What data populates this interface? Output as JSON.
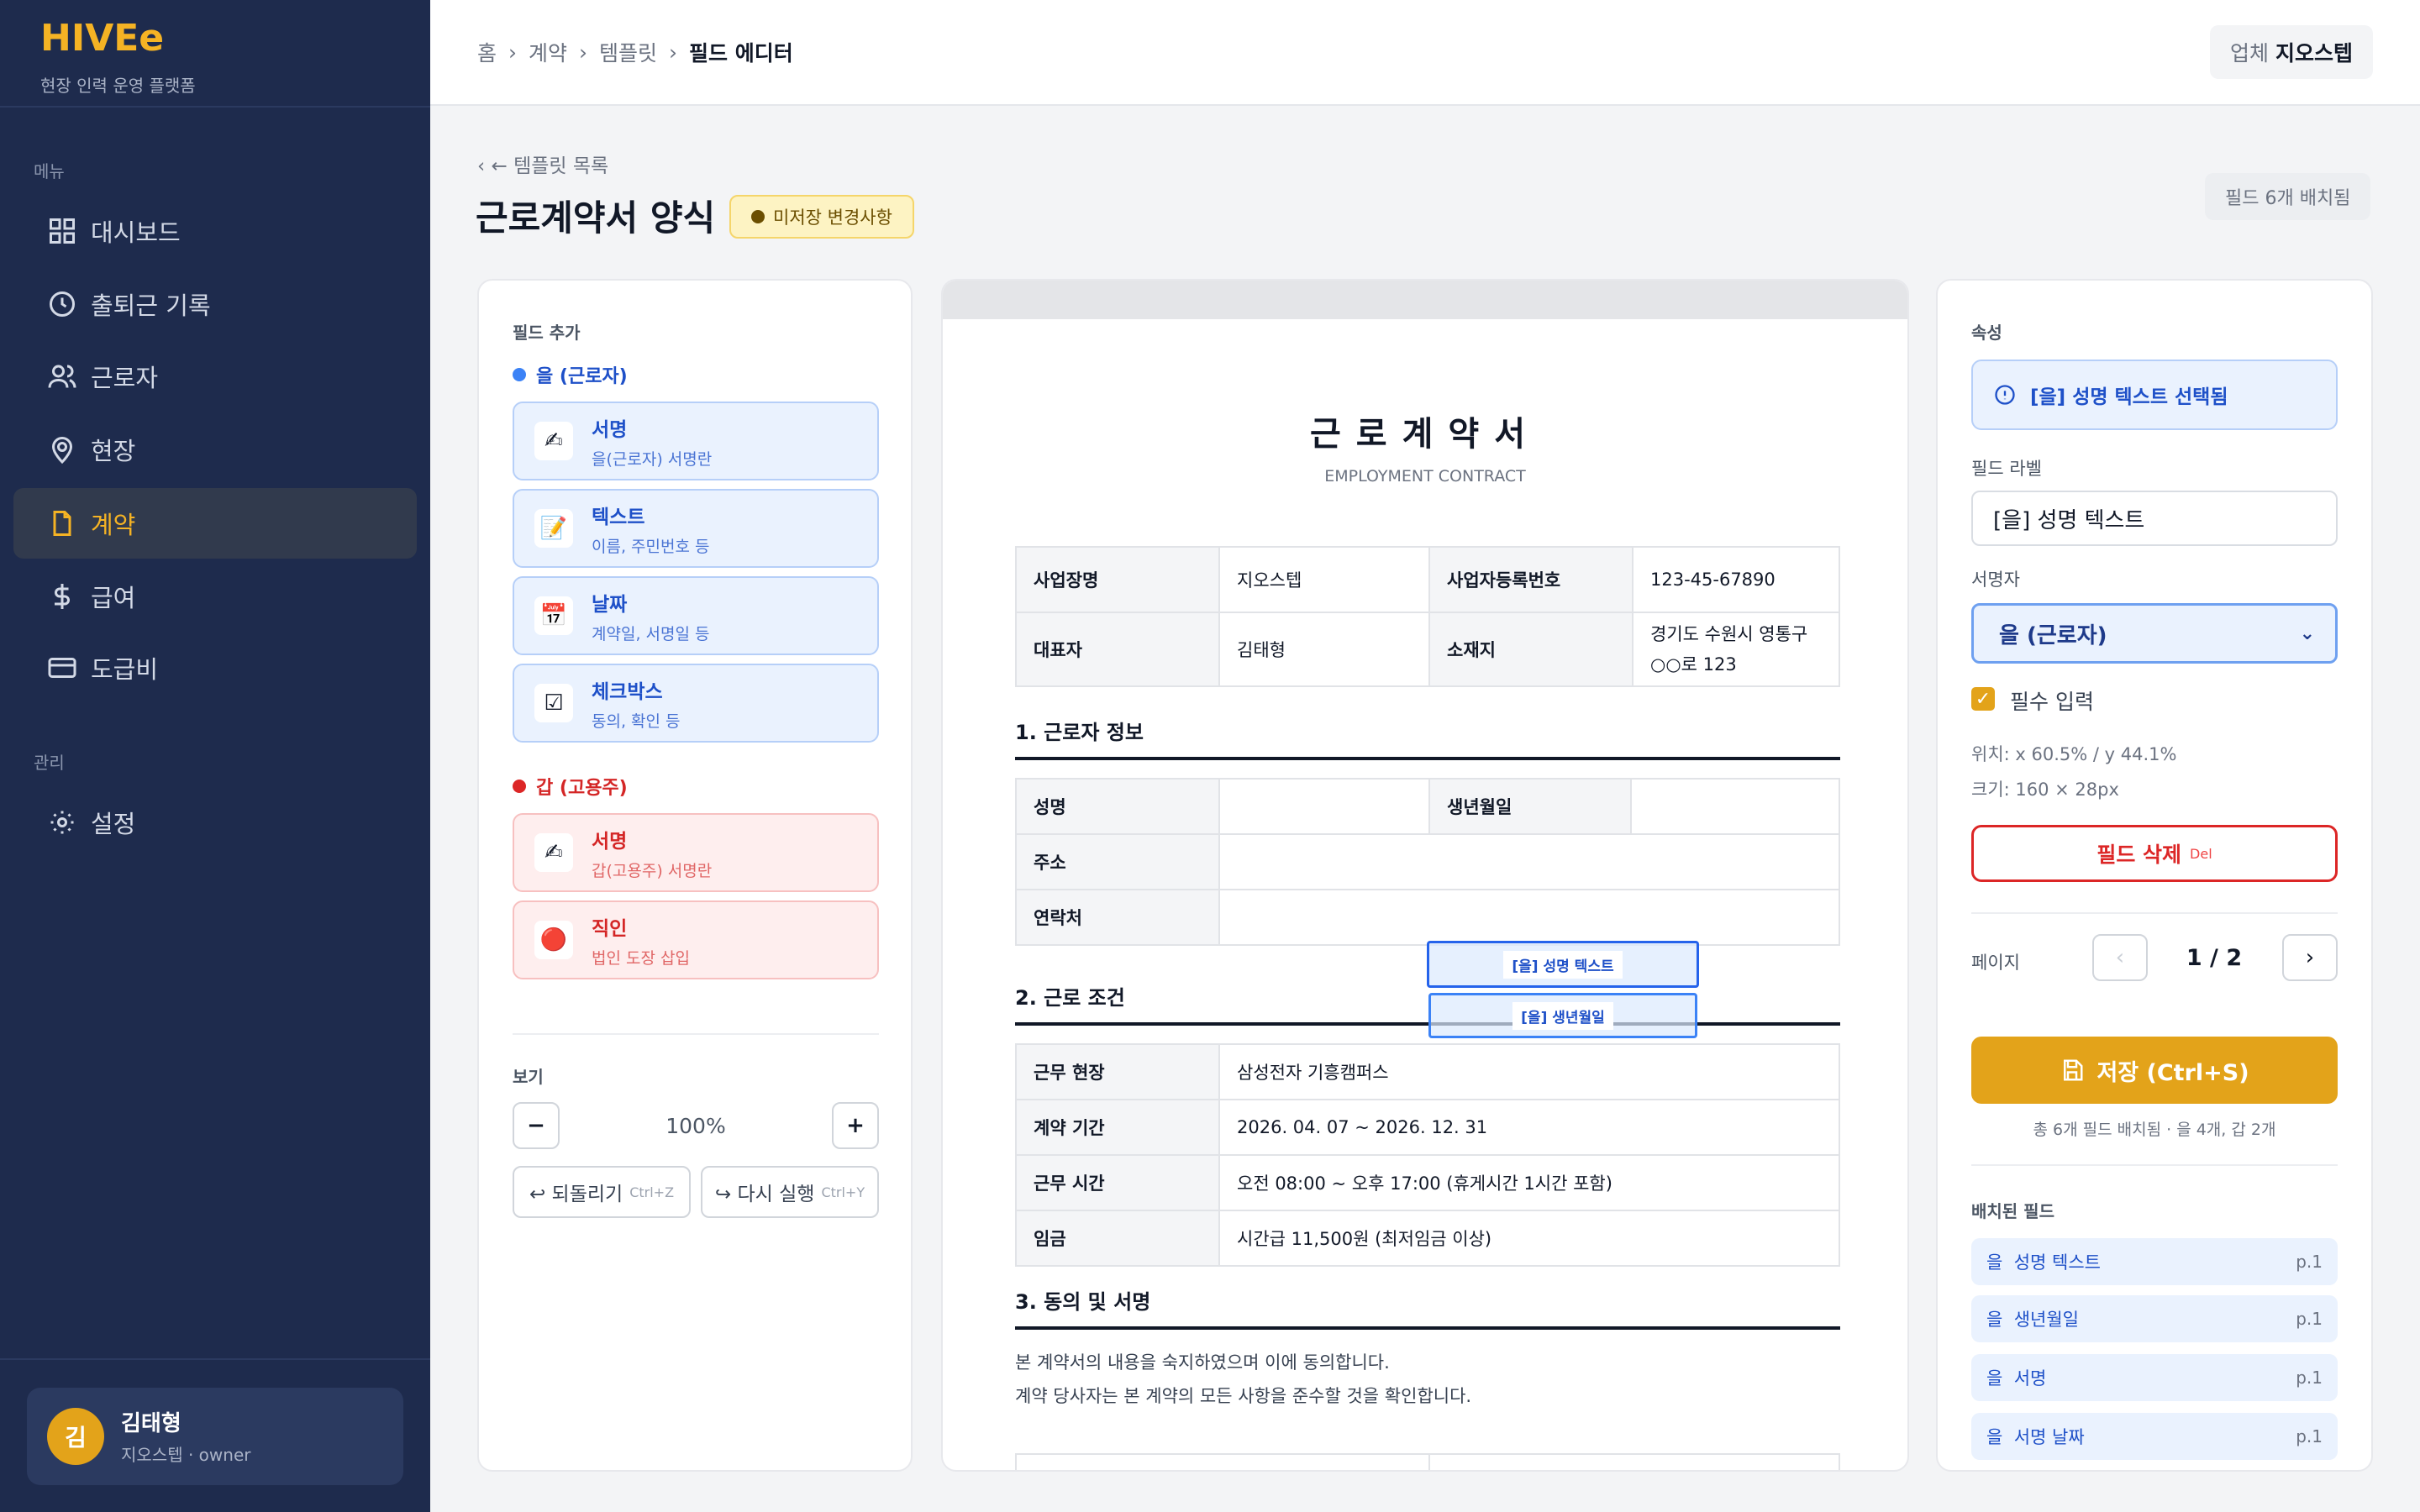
{
  "brand": {
    "name": "HIVEe",
    "subtitle": "현장 인력 운영 플랫폼"
  },
  "sidebar": {
    "menu_label": "메뉴",
    "items": [
      {
        "label": "대시보드",
        "icon": "grid-icon"
      },
      {
        "label": "출퇴근 기록",
        "icon": "clock-icon"
      },
      {
        "label": "근로자",
        "icon": "users-icon"
      },
      {
        "label": "현장",
        "icon": "map-pin-icon"
      },
      {
        "label": "계약",
        "icon": "document-icon",
        "active": true
      },
      {
        "label": "급여",
        "icon": "dollar-icon"
      },
      {
        "label": "도급비",
        "icon": "credit-card-icon"
      }
    ],
    "admin_label": "관리",
    "admin_items": [
      {
        "label": "설정",
        "icon": "gear-icon"
      }
    ],
    "user": {
      "initial": "김",
      "name": "김태형",
      "role": "지오스텝 · owner"
    }
  },
  "breadcrumb": [
    "홈",
    "계약",
    "템플릿",
    "필드 에디터"
  ],
  "company": {
    "label": "업체",
    "name": "지오스텝"
  },
  "page": {
    "back": "← 템플릿 목록",
    "title": "근로계약서 양식",
    "unsaved": "미저장 변경사항",
    "field_count": "필드 6개 배치됨"
  },
  "left_panel": {
    "add_label": "필드 추가",
    "group_b": {
      "label": "을 (근로자)",
      "color": "#3b82f6"
    },
    "cards_b": [
      {
        "title": "서명",
        "desc": "을(근로자) 서명란",
        "icon": "✍"
      },
      {
        "title": "텍스트",
        "desc": "이름, 주민번호 등",
        "icon": "📝"
      },
      {
        "title": "날짜",
        "desc": "계약일, 서명일 등",
        "icon": "📅"
      },
      {
        "title": "체크박스",
        "desc": "동의, 확인 등",
        "icon": "☑"
      }
    ],
    "group_a": {
      "label": "갑 (고용주)",
      "color": "#dc2626"
    },
    "cards_a": [
      {
        "title": "서명",
        "desc": "갑(고용주) 서명란",
        "icon": "✍"
      },
      {
        "title": "직인",
        "desc": "법인 도장 삽입",
        "icon": "🔴"
      }
    ],
    "view_label": "보기",
    "zoom_minus": "−",
    "zoom": "100%",
    "zoom_plus": "+",
    "undo": "↩ 되돌리기",
    "undo_key": "Ctrl+Z",
    "redo": "↪ 다시 실행",
    "redo_key": "Ctrl+Y"
  },
  "document": {
    "title": "근로계약서",
    "subtitle": "EMPLOYMENT CONTRACT",
    "info": [
      [
        "사업장명",
        "지오스텝",
        "사업자등록번호",
        "123-45-67890"
      ],
      [
        "대표자",
        "김태형",
        "소재지",
        "경기도 수원시 영통구 ○○로 123"
      ]
    ],
    "section1": "1. 근로자 정보",
    "worker": {
      "name": "성명",
      "birth": "생년월일",
      "address": "주소",
      "contact": "연락처"
    },
    "section2": "2. 근로 조건",
    "terms": [
      [
        "근무 현장",
        "삼성전자 기흥캠퍼스"
      ],
      [
        "계약 기간",
        "2026. 04. 07 ~ 2026. 12. 31"
      ],
      [
        "근무 시간",
        "오전 08:00 ~ 오후 17:00 (휴게시간 1시간 포함)"
      ],
      [
        "임금",
        "시간급 11,500원 (최저임금 이상)"
      ]
    ],
    "section3": "3. 동의 및 서명",
    "p1": "본 계약서의 내용을 숙지하였으며 이에 동의합니다.",
    "p2": "계약 당사자는 본 계약의 모든 사항을 준수할 것을 확인합니다.",
    "fields": [
      {
        "label": "[을] 성명 텍스트"
      },
      {
        "label": "[을] 생년월일"
      }
    ]
  },
  "props": {
    "label": "속성",
    "selected": "[을] 성명 텍스트 선택됨",
    "field_label_title": "필드 라벨",
    "field_label_value": "[을] 성명 텍스트",
    "signer_title": "서명자",
    "signer_value": "을 (근로자)",
    "required": "필수 입력",
    "position": "위치: x 60.5% / y 44.1%",
    "size": "크기: 160 × 28px",
    "delete": "필드 삭제",
    "delete_key": "Del",
    "page_label": "페이지",
    "page_value": "1 / 2",
    "save": "저장 (Ctrl+S)",
    "summary": "총 6개 필드 배치됨 · 을 4개, 갑 2개",
    "placed_label": "배치된 필드",
    "placed": [
      {
        "party": "을",
        "name": "성명 텍스트",
        "page": "p.1"
      },
      {
        "party": "을",
        "name": "생년월일",
        "page": "p.1"
      },
      {
        "party": "을",
        "name": "서명",
        "page": "p.1"
      },
      {
        "party": "을",
        "name": "서명 날짜",
        "page": "p.1"
      }
    ]
  }
}
